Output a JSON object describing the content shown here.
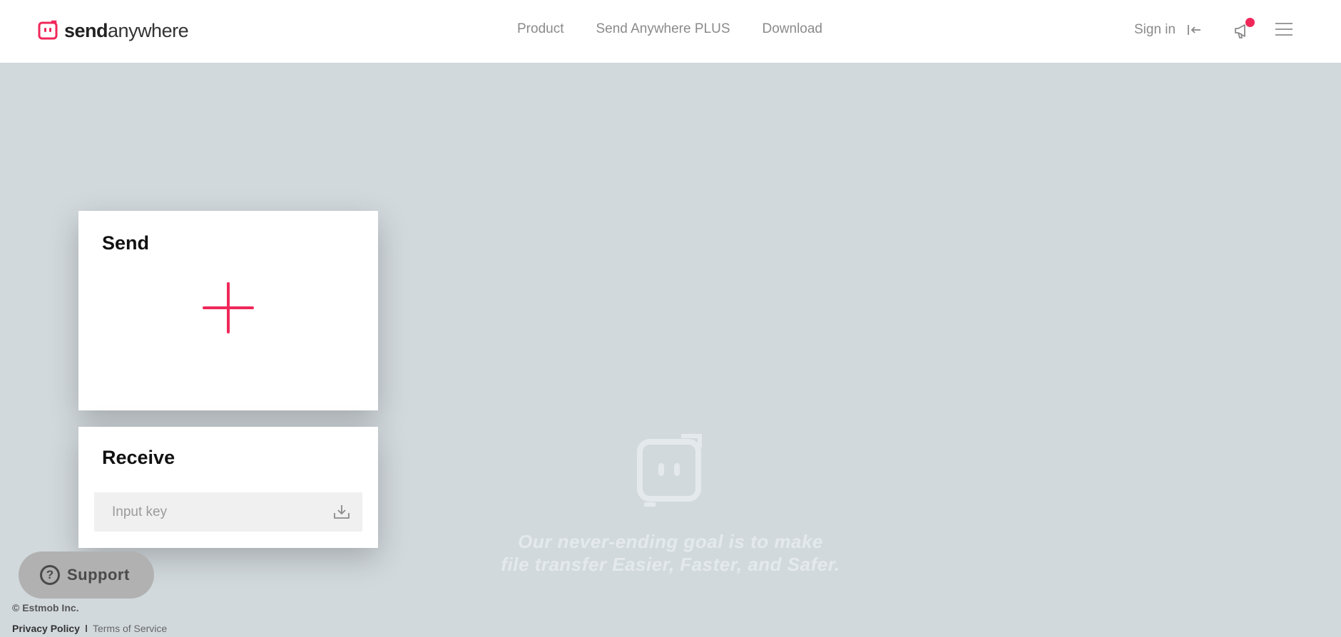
{
  "header": {
    "logo": {
      "bold": "send",
      "light": "anywhere",
      "icon": "send-anywhere-logo-icon"
    },
    "nav": [
      {
        "label": "Product"
      },
      {
        "label": "Send Anywhere PLUS"
      },
      {
        "label": "Download"
      }
    ],
    "signin_label": "Sign in",
    "notification_badge": true
  },
  "send_card": {
    "title": "Send",
    "add_icon": "plus-icon"
  },
  "receive_card": {
    "title": "Receive",
    "key_input": {
      "value": "",
      "placeholder": "Input key"
    },
    "download_icon": "download-icon"
  },
  "watermark": {
    "icon": "send-anywhere-mark-icon",
    "tagline_line1": "Our never-ending goal is to make",
    "tagline_line2": "file transfer Easier, Faster, and Safer."
  },
  "support": {
    "label": "Support",
    "icon": "question-circle-icon"
  },
  "footer": {
    "copyright": "© Estmob Inc.",
    "privacy": "Privacy Policy",
    "terms": "Terms of Service"
  },
  "colors": {
    "accent": "#f0285a",
    "background": "#d2d9dd",
    "header": "#ffffff"
  }
}
